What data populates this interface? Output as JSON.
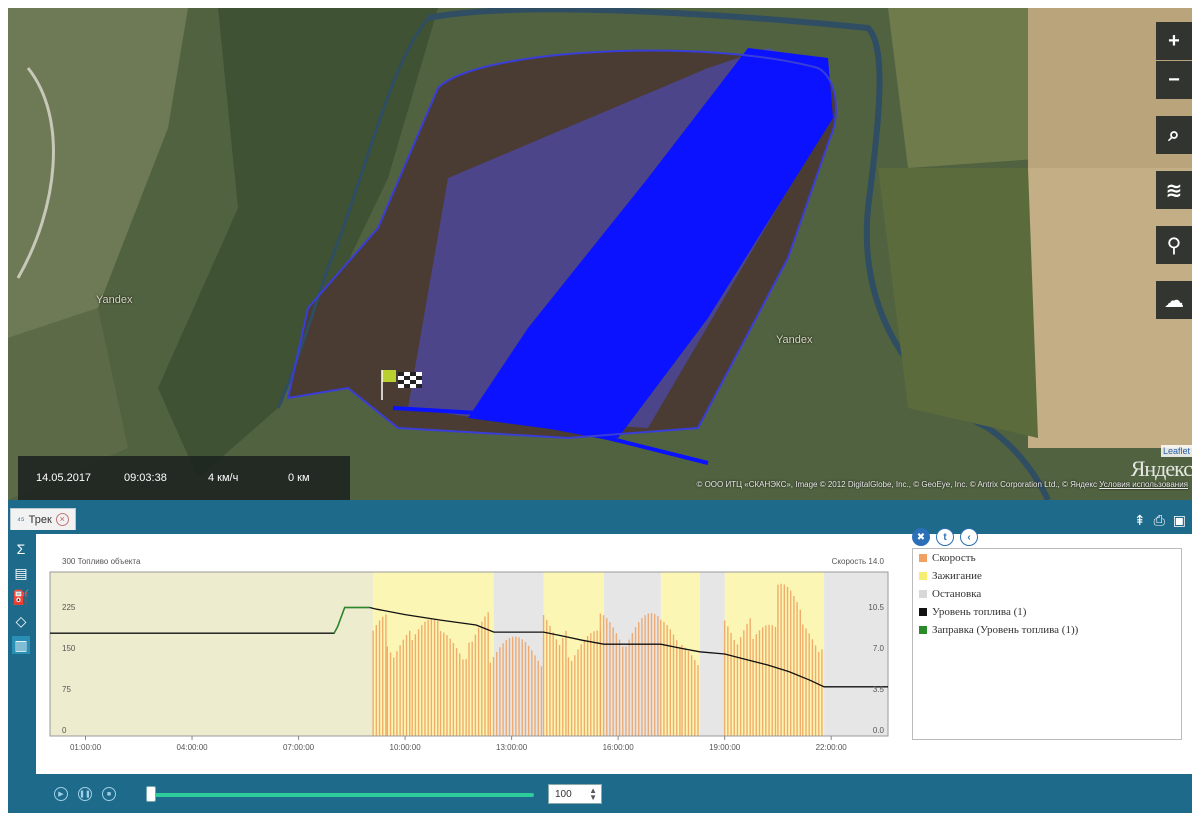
{
  "map": {
    "place_labels": [
      "Yandex",
      "Yandex"
    ],
    "info": {
      "date": "14.05.2017",
      "time": "09:03:38",
      "speed": "4 км/ч",
      "distance": "0 км"
    },
    "attribution": "© ООО ИТЦ «СКАНЭКС», Image © 2012 DigitalGlobe, Inc., © GeoEye, Inc. © Antrix Corporation Ltd., © Яндекс",
    "attribution_terms": "Условия использования",
    "leaflet": "Leaflet",
    "yandex_logo": "Яндекс",
    "controls": [
      {
        "name": "zoom-in",
        "glyph": "+"
      },
      {
        "name": "zoom-out",
        "glyph": "−"
      },
      {
        "name": "search",
        "glyph": "⌕"
      },
      {
        "name": "layers",
        "glyph": "≋"
      },
      {
        "name": "route",
        "glyph": "⚲"
      },
      {
        "name": "weather",
        "glyph": "☁"
      }
    ],
    "track_color": "#0a12ff"
  },
  "panel": {
    "tab_label": "Трек",
    "tab_icon_text": "⁴⁵",
    "tools": [
      "pin-icon",
      "print-icon",
      "save-icon"
    ],
    "side_tools": [
      {
        "name": "sum-icon",
        "glyph": "Σ"
      },
      {
        "name": "report-icon",
        "glyph": "▤"
      },
      {
        "name": "fuel-icon",
        "glyph": "⛽"
      },
      {
        "name": "shape-icon",
        "glyph": "◇"
      },
      {
        "name": "chart-icon",
        "glyph": "▥"
      }
    ],
    "legend_buttons": [
      "✖",
      "t",
      "‹"
    ],
    "legend": [
      {
        "label": "Скорость",
        "color": "#f0a060"
      },
      {
        "label": "Зажигание",
        "color": "#f5ee70"
      },
      {
        "label": "Остановка",
        "color": "#d8d8d8"
      },
      {
        "label": "Уровень топлива (1)",
        "color": "#111111"
      },
      {
        "label": "Заправка (Уровень топлива (1))",
        "color": "#2a8a2a"
      }
    ],
    "player": {
      "speed_value": "100"
    }
  },
  "chart_data": {
    "type": "line",
    "title": "",
    "left_axis_label": "300  Топливо объекта",
    "right_axis_label": "Скорость  14.0",
    "x_ticks": [
      "01:00:00",
      "04:00:00",
      "07:00:00",
      "10:00:00",
      "13:00:00",
      "16:00:00",
      "19:00:00",
      "22:00:00"
    ],
    "y_ticks_left": [
      "0",
      "75",
      "150",
      "225"
    ],
    "y_ticks_right": [
      "0.0",
      "3.5",
      "7.0",
      "10.5"
    ],
    "ylim_left": [
      0,
      300
    ],
    "ylim_right": [
      0,
      14
    ],
    "xlim_hours": [
      0,
      23.6
    ],
    "ignition_intervals": [
      [
        9.1,
        12.5
      ],
      [
        13.9,
        15.6
      ],
      [
        17.2,
        18.3
      ],
      [
        19.0,
        21.8
      ]
    ],
    "stop_intervals": [
      [
        12.5,
        13.9
      ],
      [
        15.6,
        17.2
      ],
      [
        18.3,
        19.0
      ],
      [
        21.8,
        23.6
      ]
    ],
    "pre_ignition_interval": [
      0,
      9.1
    ],
    "series": [
      {
        "name": "Уровень топлива (1)",
        "color": "#111111",
        "x": [
          0,
          8.0,
          8.1,
          8.3,
          9.0,
          9.2,
          10.0,
          11.0,
          12.0,
          12.5,
          13.9,
          14.5,
          15.0,
          15.6,
          17.2,
          17.8,
          18.3,
          19.0,
          19.6,
          20.2,
          20.8,
          21.4,
          21.8,
          23.6
        ],
        "values": [
          188,
          188,
          200,
          235,
          235,
          232,
          222,
          212,
          203,
          190,
          190,
          182,
          175,
          168,
          168,
          160,
          154,
          150,
          140,
          130,
          118,
          102,
          90,
          90
        ]
      },
      {
        "name": "Заправка (Уровень топлива (1))",
        "color": "#2a8a2a",
        "x": [
          8.0,
          8.1,
          8.3,
          9.0
        ],
        "values": [
          188,
          200,
          235,
          235
        ]
      },
      {
        "name": "Скорость",
        "color": "#f0a060",
        "x": [
          9.1,
          9.5,
          10.2,
          11.0,
          11.8,
          12.4,
          13.9,
          14.6,
          15.5,
          17.2,
          17.8,
          18.3,
          19.0,
          19.8,
          20.5,
          21.2,
          21.8
        ],
        "values": [
          10.5,
          9.5,
          10.0,
          9.0,
          11.0,
          8.5,
          11.0,
          9.0,
          10.5,
          10.0,
          8.0,
          9.0,
          11.0,
          9.5,
          13.0,
          10.0,
          11.0
        ]
      }
    ],
    "legend_position": "right"
  }
}
